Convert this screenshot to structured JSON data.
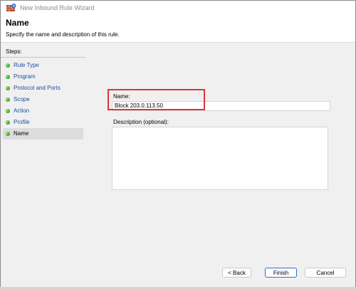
{
  "window": {
    "title": "New Inbound Rule Wizard"
  },
  "header": {
    "title": "Name",
    "description": "Specify the name and description of this rule."
  },
  "steps": {
    "heading": "Steps:",
    "items": [
      {
        "label": "Rule Type"
      },
      {
        "label": "Program"
      },
      {
        "label": "Protocol and Ports"
      },
      {
        "label": "Scope"
      },
      {
        "label": "Action"
      },
      {
        "label": "Profile"
      },
      {
        "label": "Name"
      }
    ],
    "active_index": 6
  },
  "form": {
    "name_label": "Name:",
    "name_value": "Block 203.0.113.50",
    "description_label": "Description (optional):",
    "description_value": ""
  },
  "buttons": {
    "back_label": "< Back",
    "finish_label": "Finish",
    "cancel_label": "Cancel"
  },
  "colors": {
    "highlight": "#e0343a",
    "step_link": "#1a4fa0",
    "status_dot": "#3fa92a"
  },
  "icons": {
    "window_icon": "firewall-icon",
    "step_bullet": "green-dot-icon"
  }
}
